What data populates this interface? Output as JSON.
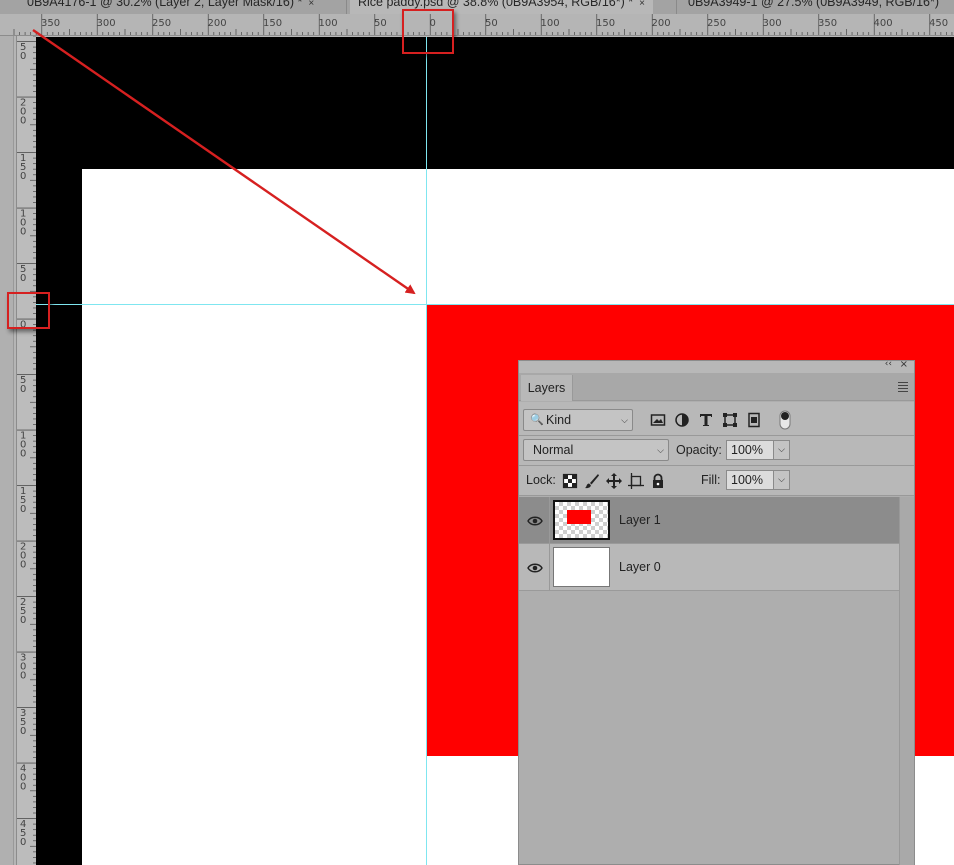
{
  "tabs": [
    {
      "label": "0B9A4176-1 @ 30.2% (Layer 2, Layer Mask/16) *",
      "active": false
    },
    {
      "label": "Rice paddy.psd @ 38.8% (0B9A3954, RGB/16*) *",
      "active": true
    },
    {
      "label": "0B9A3949-1 @ 27.5% (0B9A3949, RGB/16*)",
      "active": false
    }
  ],
  "tab_close_glyph": "×",
  "horizontal_ruler": {
    "labels": [
      "350",
      "300",
      "250",
      "200",
      "150",
      "100",
      "50",
      "0",
      "50",
      "100",
      "150",
      "200",
      "250",
      "300",
      "350",
      "400",
      "450"
    ]
  },
  "vertical_ruler": {
    "labels": [
      "50",
      "200",
      "150",
      "100",
      "50",
      "0",
      "50",
      "100",
      "150",
      "200",
      "250",
      "300",
      "350",
      "400",
      "450"
    ]
  },
  "colors": {
    "canvas_background": "#000000",
    "document": "#ffffff",
    "red_layer": "#ff0000",
    "guide": "#7fe6f0",
    "annotation": "#d62020"
  },
  "layers_panel": {
    "collapse_glyph": "‹‹",
    "close_glyph": "×",
    "tab_label": "Layers",
    "filter": {
      "label": "Kind",
      "icons": [
        "image-filter-icon",
        "adjustment-filter-icon",
        "type-filter-icon",
        "shape-filter-icon",
        "smart-object-filter-icon",
        "filter-toggle-icon"
      ]
    },
    "blend_mode": "Normal",
    "opacity_label": "Opacity:",
    "opacity_value": "100%",
    "lock_label": "Lock:",
    "lock_icons": [
      "lock-transparent-pixels-icon",
      "lock-image-pixels-icon",
      "lock-position-icon",
      "lock-artboard-icon",
      "lock-all-icon"
    ],
    "fill_label": "Fill:",
    "fill_value": "100%",
    "layers": [
      {
        "name": "Layer 1",
        "selected": true,
        "visible": true,
        "thumbnail": "red-rectangle-on-transparent"
      },
      {
        "name": "Layer 0",
        "selected": false,
        "visible": true,
        "thumbnail": "white"
      }
    ]
  }
}
